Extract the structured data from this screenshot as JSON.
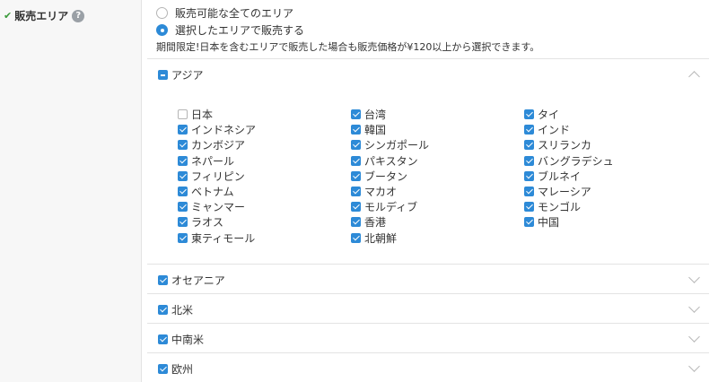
{
  "field": {
    "label": "販売エリア",
    "help": "?"
  },
  "radio": {
    "all_areas": "販売可能な全てのエリア",
    "selected_areas": "選択したエリアで販売する"
  },
  "notice": "期間限定!日本を含むエリアで販売した場合も販売価格が¥120以上から選択できます。",
  "regions": {
    "asia": {
      "label": "アジア",
      "columns": [
        [
          {
            "name": "日本",
            "checked": false
          },
          {
            "name": "インドネシア",
            "checked": true
          },
          {
            "name": "カンボジア",
            "checked": true
          },
          {
            "name": "ネパール",
            "checked": true
          },
          {
            "name": "フィリピン",
            "checked": true
          },
          {
            "name": "ベトナム",
            "checked": true
          },
          {
            "name": "ミャンマー",
            "checked": true
          },
          {
            "name": "ラオス",
            "checked": true
          },
          {
            "name": "東ティモール",
            "checked": true
          }
        ],
        [
          {
            "name": "台湾",
            "checked": true
          },
          {
            "name": "韓国",
            "checked": true
          },
          {
            "name": "シンガポール",
            "checked": true
          },
          {
            "name": "パキスタン",
            "checked": true
          },
          {
            "name": "ブータン",
            "checked": true
          },
          {
            "name": "マカオ",
            "checked": true
          },
          {
            "name": "モルディブ",
            "checked": true
          },
          {
            "name": "香港",
            "checked": true
          },
          {
            "name": "北朝鮮",
            "checked": true
          }
        ],
        [
          {
            "name": "タイ",
            "checked": true
          },
          {
            "name": "インド",
            "checked": true
          },
          {
            "name": "スリランカ",
            "checked": true
          },
          {
            "name": "バングラデシュ",
            "checked": true
          },
          {
            "name": "ブルネイ",
            "checked": true
          },
          {
            "name": "マレーシア",
            "checked": true
          },
          {
            "name": "モンゴル",
            "checked": true
          },
          {
            "name": "中国",
            "checked": true
          }
        ]
      ]
    },
    "oceania": {
      "label": "オセアニア"
    },
    "north_america": {
      "label": "北米"
    },
    "latin_america": {
      "label": "中南米"
    },
    "europe": {
      "label": "欧州"
    }
  }
}
